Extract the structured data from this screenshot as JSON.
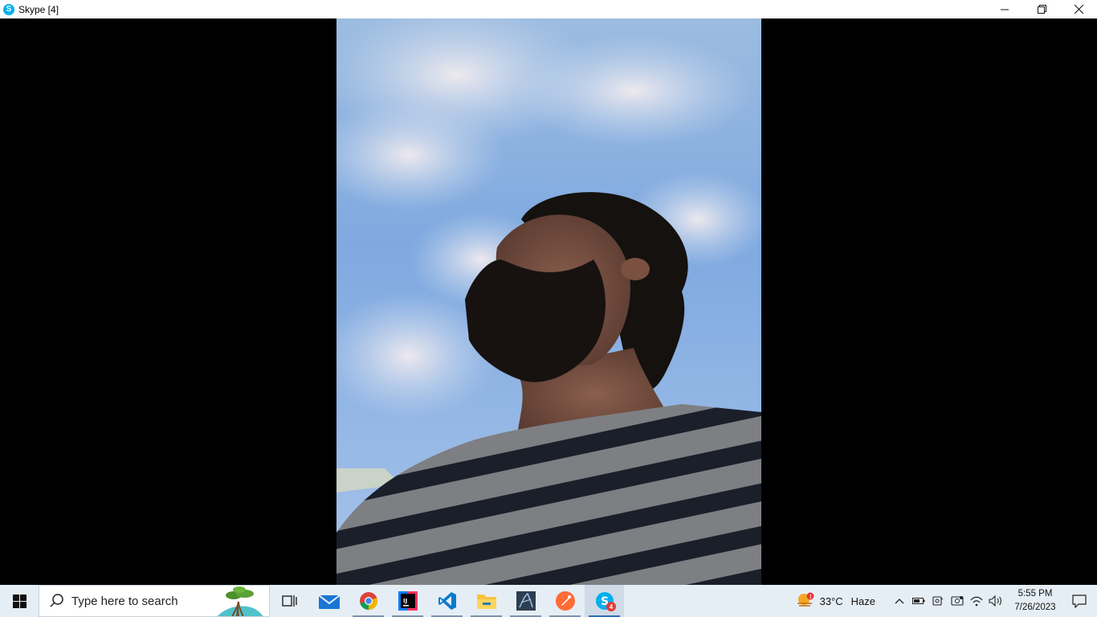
{
  "window": {
    "title": "Skype [4]",
    "app_logo_letter": "S"
  },
  "taskbar": {
    "search_placeholder": "Type here to search",
    "apps": [
      {
        "name": "task-view",
        "icon": "task-view-icon"
      },
      {
        "name": "mail",
        "icon": "mail-icon"
      },
      {
        "name": "chrome",
        "icon": "chrome-icon"
      },
      {
        "name": "intellij",
        "icon": "intellij-icon",
        "label": "IJ"
      },
      {
        "name": "vscode",
        "icon": "vscode-icon"
      },
      {
        "name": "file-explorer",
        "icon": "folder-icon"
      },
      {
        "name": "sql-server",
        "icon": "database-icon"
      },
      {
        "name": "postman",
        "icon": "postman-icon"
      },
      {
        "name": "skype",
        "icon": "skype-icon",
        "badge": "4"
      }
    ],
    "weather": {
      "temperature": "33°C",
      "condition": "Haze",
      "alert_count": "1"
    },
    "clock": {
      "time": "5:55 PM",
      "date": "7/26/2023"
    }
  },
  "colors": {
    "skype_blue": "#00aff0",
    "taskbar_bg": "#e6eef5"
  }
}
